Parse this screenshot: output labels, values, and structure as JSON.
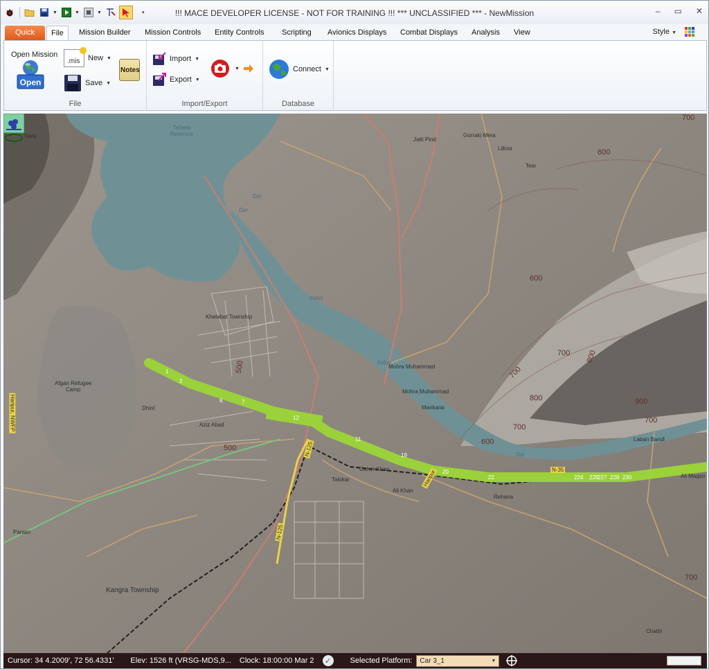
{
  "window": {
    "title": "!!! MACE DEVELOPER LICENSE - NOT FOR TRAINING !!!   *** UNCLASSIFIED ***  - NewMission"
  },
  "window_controls": {
    "minimize": "–",
    "restore": "▭",
    "close": "✕"
  },
  "tabs": [
    "Quick",
    "File",
    "Mission Builder",
    "Mission Controls",
    "Entity Controls",
    "Scripting",
    "Avionics Displays",
    "Combat Displays",
    "Analysis",
    "View"
  ],
  "style_menu": "Style",
  "ribbon": {
    "file": {
      "open_mission_label": "Open Mission",
      "open_button": "Open",
      "new_label": "New",
      "new_icon_text": ".mis",
      "save_label": "Save",
      "notes_label": "Notes",
      "group_label": "File"
    },
    "import_export": {
      "import_label": "Import",
      "export_label": "Export",
      "group_label": "Import/Export"
    },
    "database": {
      "connect_label": "Connect",
      "group_label": "Database"
    }
  },
  "map": {
    "water_labels": [
      "Tarbela\nReservoir",
      "Dor",
      "Dor",
      "Indus",
      "Indus",
      "Dor"
    ],
    "place_labels": [
      "Nara",
      "Jatti Pind",
      "Gorraki Mera",
      "Lilloor",
      "Teer",
      "Khalabat Township",
      "Afgan Refugee\nCamp",
      "Dhinl",
      "Aziz Abad",
      "Mohra Muhammad",
      "Mohra Muhammad",
      "Mankarai",
      "Laban Bandi",
      "Geher Khan",
      "Talokar",
      "Ali Khan",
      "Rehana",
      "Ali Maqso",
      "Panian",
      "Kangra Township",
      "Chattri",
      "Haripur",
      "Haripur, NWFP",
      "N-125",
      "N-125",
      "N-35"
    ],
    "contours": [
      "700",
      "600",
      "600",
      "700",
      "800",
      "700",
      "800",
      "900",
      "700",
      "700",
      "600",
      "500",
      "500",
      "700"
    ],
    "route_marks": [
      "1",
      "2",
      "6",
      "7",
      "12",
      "11",
      "19",
      "20",
      "22",
      "224",
      "225",
      "227",
      "228",
      "230"
    ]
  },
  "status": {
    "cursor": "Cursor: 34 4.2009', 72 56.4331'",
    "elev": "Elev: 1526 ft (VRSG-MDS,9...",
    "clock": "Clock: 18:00:00   Mar 2",
    "selected_platform_label": "Selected Platform:",
    "selected_platform_value": "Car 3_1"
  }
}
